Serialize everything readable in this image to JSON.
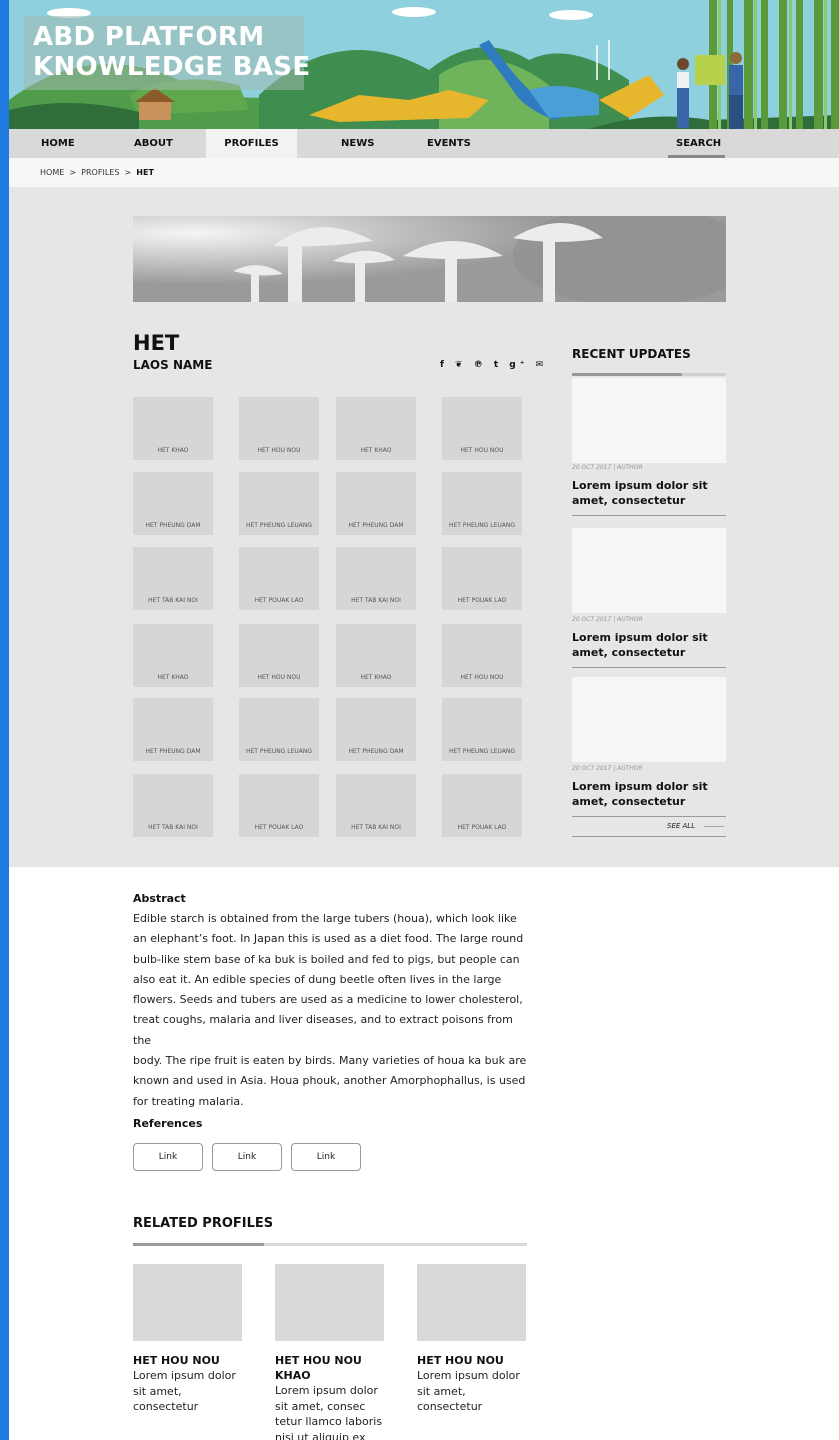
{
  "banner": {
    "title_line1": "ABD PLATFORM",
    "title_line2": "KNOWLEDGE BASE"
  },
  "nav": {
    "home": "HOME",
    "about": "ABOUT",
    "profiles": "PROFILES",
    "news": "NEWS",
    "events": "EVENTS",
    "search": "SEARCH"
  },
  "breadcrumb": {
    "home": "HOME",
    "sep": ">",
    "profiles": "PROFILES",
    "current": "HET"
  },
  "profile": {
    "title": "HET",
    "subtitle": "LAOS NAME"
  },
  "share_icons": [
    "facebook-icon",
    "twitter-icon",
    "pinterest-icon",
    "tumblr-icon",
    "google-plus-icon",
    "mail-icon"
  ],
  "share_glyphs": "f ❦ ℗ t g⁺ ✉",
  "tiles": [
    "HET KHAO",
    "HET HOU NOU",
    "HET KHAO",
    "HET HOU NOU",
    "HET PHEUNG DAM",
    "HET PHEUNG  LEUANG",
    "HET PHEUNG DAM",
    "HET PHEUNG  LEUANG",
    "HET TAB KAI NOI",
    "HET POUAK LAO",
    "HET TAB KAI NOI",
    "HET POUAK LAO",
    "HET KHAO",
    "HET HOU NOU",
    "HET KHAO",
    "HET HOU NOU",
    "HET PHEUNG DAM",
    "HET PHEUNG  LEUANG",
    "HET PHEUNG DAM",
    "HET PHEUNG  LEUANG",
    "HET TAB KAI NOI",
    "HET POUAK LAO",
    "HET TAB KAI NOI",
    "HET POUAK LAO"
  ],
  "recent": {
    "title": "RECENT UPDATES",
    "items": [
      {
        "meta": "20 OCT 2017  |  AUTHOR",
        "line1": "Lorem ipsum dolor sit",
        "line2": "amet, consectetur"
      },
      {
        "meta": "20 OCT 2017  |  AUTHOR",
        "line1": "Lorem ipsum dolor sit",
        "line2": "amet, consectetur"
      },
      {
        "meta": "20 OCT 2017  |  AUTHOR",
        "line1": "Lorem ipsum dolor sit",
        "line2": "amet, consectetur"
      }
    ],
    "see_all": "SEE ALL"
  },
  "abstract": {
    "heading": "Abstract",
    "lines": [
      "Edible starch is obtained from the large tubers (houa), which look like",
      "an elephant’s foot. In Japan this is used as a diet food. The large round",
      "bulb-like stem base of ka buk is boiled and fed to pigs, but people can",
      "also eat it. An edible species of dung beetle often lives in the large",
      "flowers. Seeds and tubers are used as a medicine to lower cholesterol,",
      "treat coughs, malaria and liver diseases, and to extract poisons from the",
      "body. The ripe fruit is eaten by birds. Many varieties of houa ka buk are",
      "known and used in Asia. Houa phouk, another Amorphophallus, is used",
      "for treating malaria."
    ]
  },
  "references": {
    "heading": "References",
    "links": [
      "Link",
      "Link",
      "Link"
    ]
  },
  "related": {
    "heading": "RELATED PROFILES",
    "items": [
      {
        "title1": "HET HOU NOU",
        "title2": "",
        "desc": [
          "Lorem ipsum dolor",
          "sit amet,",
          "consectetur"
        ]
      },
      {
        "title1": "HET HOU NOU",
        "title2": "KHAO",
        "desc": [
          "Lorem ipsum dolor",
          "sit amet, consec",
          "tetur llamco laboris",
          "nisi ut aliquip ex"
        ]
      },
      {
        "title1": "HET HOU NOU",
        "title2": "",
        "desc": [
          "Lorem ipsum dolor",
          "sit amet,",
          "consectetur"
        ]
      }
    ]
  },
  "colors": {
    "accent_strip": "#1f7ae0",
    "banner_sky": "#8fd0df",
    "nav_bg": "#d9d9d9",
    "page_grey": "#e6e6e6"
  }
}
